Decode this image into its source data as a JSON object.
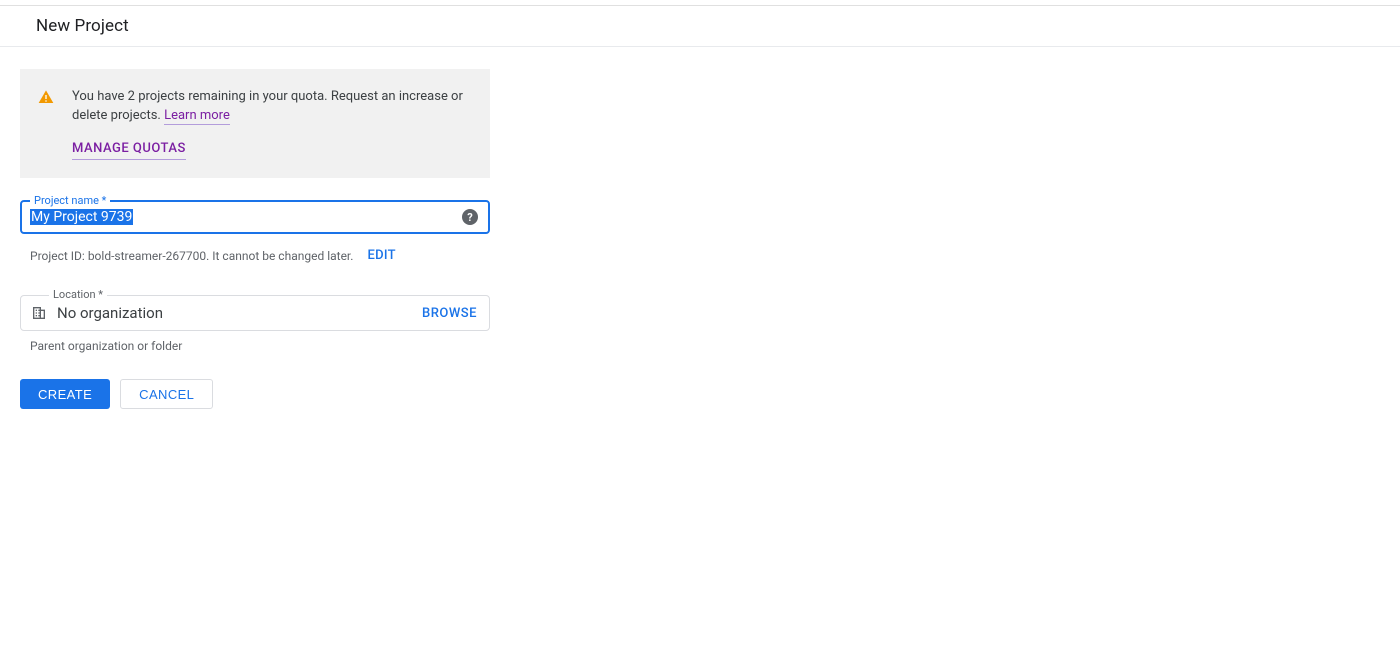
{
  "header": {
    "title": "New Project"
  },
  "alert": {
    "body_prefix": "You have 2 projects remaining in your quota. Request an increase or delete projects. ",
    "learn_more": "Learn more",
    "manage_quotas": "MANAGE QUOTAS"
  },
  "project_name": {
    "label": "Project name *",
    "value": "My Project 9739",
    "help_glyph": "?"
  },
  "project_id": {
    "prefix": "Project ID: ",
    "id": "bold-streamer-267700",
    "suffix": ". It cannot be changed later.",
    "edit": "EDIT"
  },
  "location": {
    "label": "Location *",
    "value": "No organization",
    "browse": "BROWSE",
    "helper": "Parent organization or folder"
  },
  "buttons": {
    "create": "CREATE",
    "cancel": "CANCEL"
  }
}
